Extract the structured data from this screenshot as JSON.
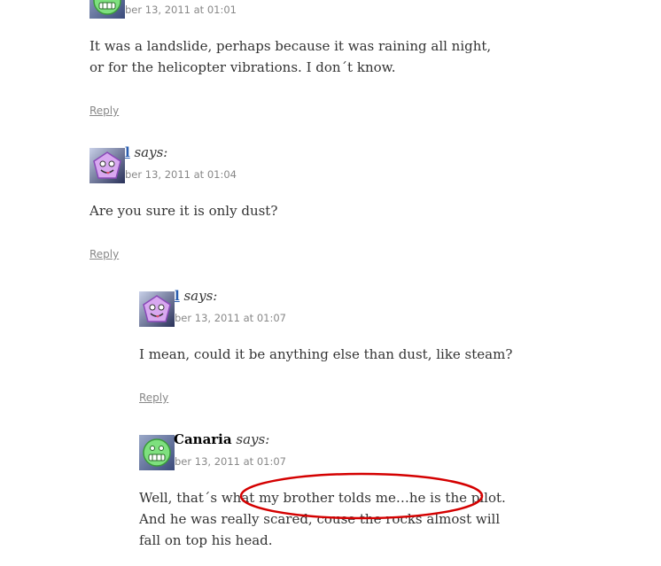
{
  "comments": [
    {
      "author": "",
      "says": "",
      "date": "ber 13, 2011 at 01:01",
      "body": "It was a landslide, perhaps because it was raining all night, or for the helicopter vibrations. I don´t know.",
      "reply_label": "Reply",
      "avatar": "green-smiley-avatar"
    },
    {
      "author": "l",
      "says": "says:",
      "date": "ber 13, 2011 at 01:04",
      "body": "Are you sure it is only dust?",
      "reply_label": "Reply",
      "avatar": "purple-pentagon-avatar"
    },
    {
      "author": "l",
      "says": "says:",
      "date": "ber 13, 2011 at 01:07",
      "body": "I mean, could it be anything else than dust, like steam?",
      "reply_label": "Reply",
      "avatar": "purple-pentagon-avatar"
    },
    {
      "author": "Canaria",
      "says": "says:",
      "date": "ber 13, 2011 at 01:07",
      "body": "Well, that´s what my brother tolds me…he is the pilot. And he was really scared, couse the rocks almost will fall on top his head.",
      "avatar": "green-smiley-avatar"
    }
  ],
  "colors": {
    "link": "#2a5db0",
    "meta": "#888888",
    "annotation": "#d40000"
  }
}
